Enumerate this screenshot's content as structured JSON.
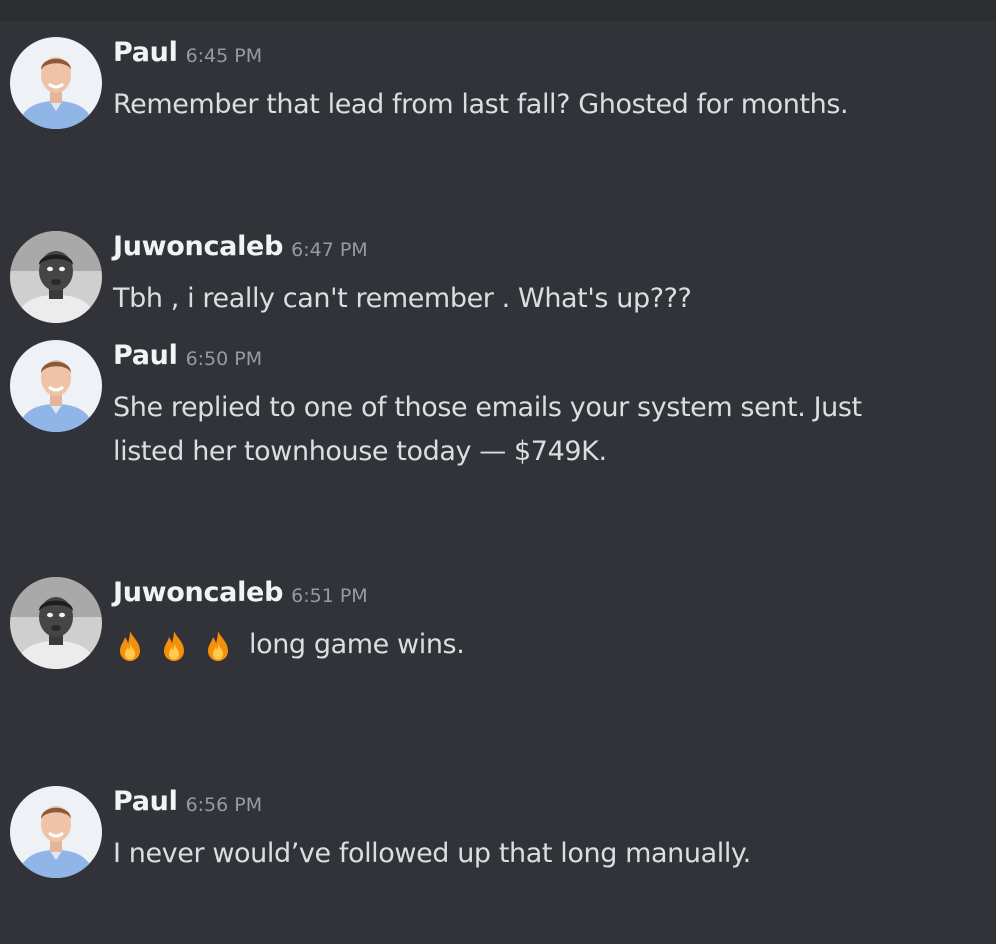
{
  "messages": [
    {
      "author": "Paul",
      "time": "6:45 PM",
      "avatar_icon": "avatar-paul",
      "lines": [
        "Remember that lead from last fall? Ghosted for months."
      ]
    },
    {
      "author": "Juwoncaleb",
      "time": "6:47 PM",
      "avatar_icon": "avatar-juwoncaleb",
      "lines": [
        "Tbh , i really can't remember . What's up???"
      ]
    },
    {
      "author": "Paul",
      "time": "6:50 PM",
      "avatar_icon": "avatar-paul",
      "lines": [
        "She replied to one of those emails your system sent. Just",
        "listed her townhouse today — $749K."
      ]
    },
    {
      "author": "Juwoncaleb",
      "time": "6:51 PM",
      "avatar_icon": "avatar-juwoncaleb",
      "emoji": [
        "fire-emoji",
        "fire-emoji",
        "fire-emoji"
      ],
      "lines": [
        "long game wins."
      ]
    },
    {
      "author": "Paul",
      "time": "6:56 PM",
      "avatar_icon": "avatar-paul",
      "lines": [
        "I never would’ve followed up that long manually."
      ]
    }
  ],
  "colors": {
    "background": "#313338",
    "top_bar": "#2b2d31",
    "username": "#f2f3f5",
    "timestamp": "#949ba4",
    "text": "#dbdee1"
  }
}
